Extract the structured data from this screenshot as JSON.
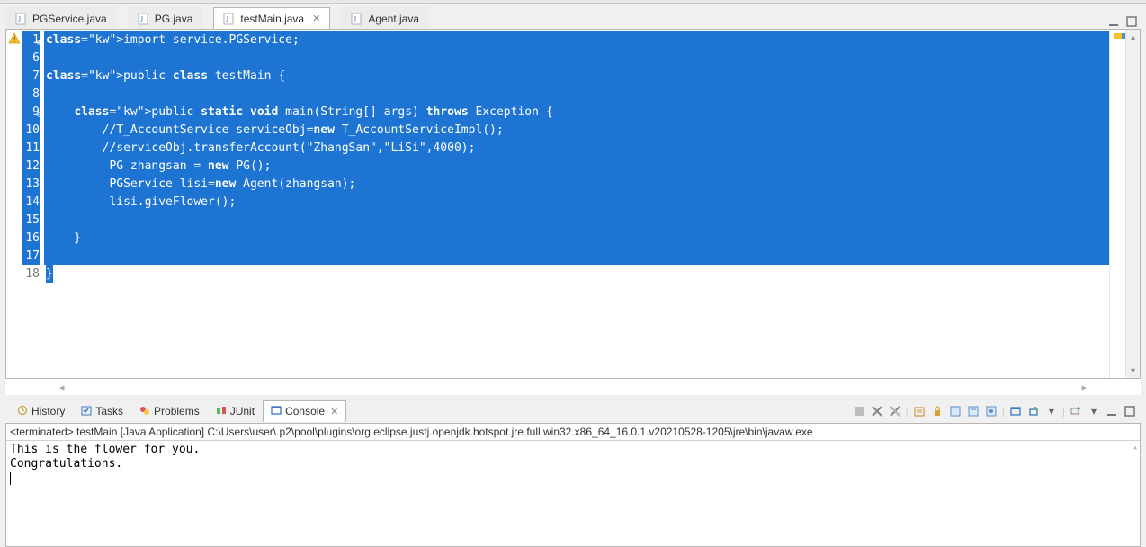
{
  "tabs": [
    {
      "label": "PGService.java",
      "active": false
    },
    {
      "label": "PG.java",
      "active": false
    },
    {
      "label": "testMain.java",
      "active": true
    },
    {
      "label": "Agent.java",
      "active": false
    }
  ],
  "code_lines": [
    {
      "n": "1",
      "text": "import service.PGService;",
      "sel": true,
      "fold": "⊕",
      "marker": "warn"
    },
    {
      "n": "6",
      "text": "",
      "sel": true
    },
    {
      "n": "7",
      "text": "public class testMain {",
      "sel": true
    },
    {
      "n": "8",
      "text": "",
      "sel": true
    },
    {
      "n": "9",
      "text": "    public static void main(String[] args) throws Exception {",
      "sel": true,
      "fold": "⊖"
    },
    {
      "n": "10",
      "text": "        //T_AccountService serviceObj=new T_AccountServiceImpl();",
      "sel": true
    },
    {
      "n": "11",
      "text": "        //serviceObj.transferAccount(\"ZhangSan\",\"LiSi\",4000);",
      "sel": true
    },
    {
      "n": "12",
      "text": "         PG zhangsan = new PG();",
      "sel": true
    },
    {
      "n": "13",
      "text": "         PGService lisi=new Agent(zhangsan);",
      "sel": true
    },
    {
      "n": "14",
      "text": "         lisi.giveFlower();",
      "sel": true
    },
    {
      "n": "15",
      "text": "",
      "sel": true
    },
    {
      "n": "16",
      "text": "    }",
      "sel": true
    },
    {
      "n": "17",
      "text": "",
      "sel": true
    },
    {
      "n": "18",
      "text": "}",
      "sel": false,
      "partial": "}"
    }
  ],
  "keywords": [
    "import",
    "public",
    "class",
    "static",
    "void",
    "throws",
    "new"
  ],
  "bottom_tabs": [
    {
      "label": "History",
      "icon": "history"
    },
    {
      "label": "Tasks",
      "icon": "tasks"
    },
    {
      "label": "Problems",
      "icon": "problems"
    },
    {
      "label": "JUnit",
      "icon": "junit"
    },
    {
      "label": "Console",
      "icon": "console",
      "active": true
    }
  ],
  "console": {
    "title": "<terminated> testMain [Java Application] C:\\Users\\user\\.p2\\pool\\plugins\\org.eclipse.justj.openjdk.hotspot.jre.full.win32.x86_64_16.0.1.v20210528-1205\\jre\\bin\\javaw.exe",
    "lines": [
      "This is the flower for you.",
      "Congratulations."
    ]
  }
}
